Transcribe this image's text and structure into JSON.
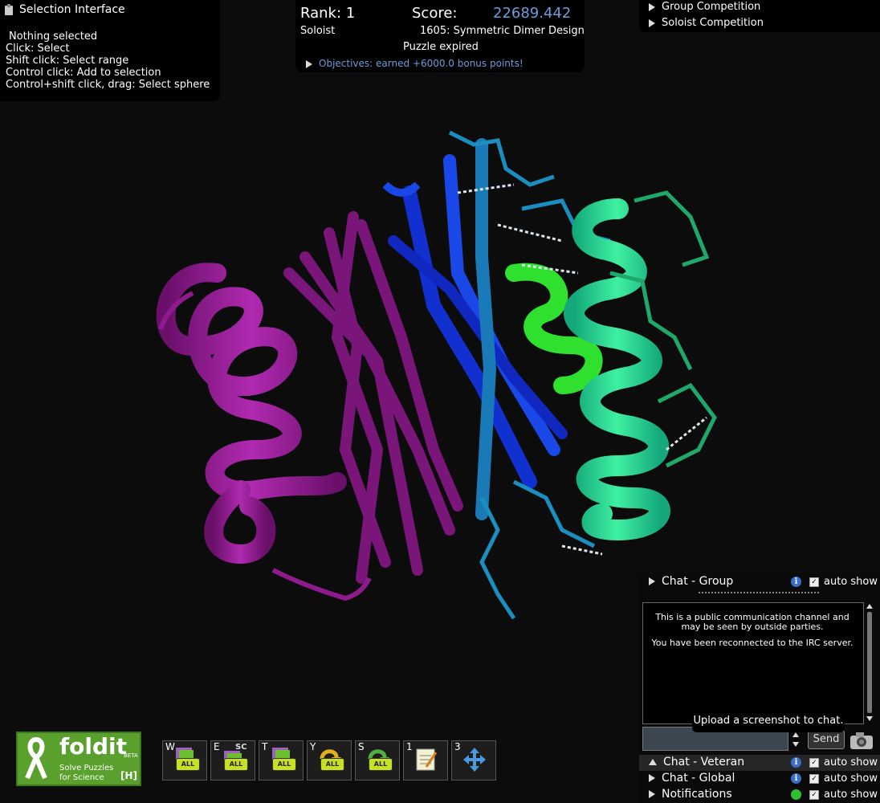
{
  "selection": {
    "title": "Selection Interface",
    "status": "Nothing selected",
    "hints": [
      "Click: Select",
      "Shift click: Select range",
      "Control click: Add to selection",
      "Control+shift click, drag: Select sphere"
    ]
  },
  "score": {
    "rank_label": "Rank: 1",
    "score_label": "Score:",
    "score_value": "22689.442",
    "mode": "Soloist",
    "puzzle": "1605: Symmetric Dimer Design",
    "status": "Puzzle expired",
    "objectives": "Objectives: earned +6000.0 bonus points!"
  },
  "competition": {
    "items": [
      "Group Competition",
      "Soloist Competition"
    ]
  },
  "chat": {
    "group": "Chat - Group",
    "auto_show": "auto show",
    "message_1": "This is a public communication channel and may be seen by outside parties.",
    "message_2": "You have been reconnected to the IRC server.",
    "send": "Send",
    "tooltip": "Upload a screenshot to chat.",
    "veteran": "Chat - Veteran",
    "global": "Chat - Global",
    "notifications": "Notifications"
  },
  "toolbar": {
    "keys": [
      "W",
      "E",
      "T",
      "Y",
      "S",
      "1",
      "3"
    ],
    "badge_all": "ALL",
    "badge_sc": "SC"
  },
  "logo": {
    "brand": "foldit",
    "beta": "BETA",
    "tagline_1": "Solve Puzzles",
    "tagline_2": "for Science",
    "hotkey": "[H]"
  },
  "colors": {
    "score_value": "#6f9bd9",
    "objectives": "#6f9bd9",
    "chain_magenta": "#8e1a8e",
    "chain_blue": "#1a3ee0",
    "chain_cyan": "#1a8fbf",
    "chain_green": "#20e060"
  }
}
